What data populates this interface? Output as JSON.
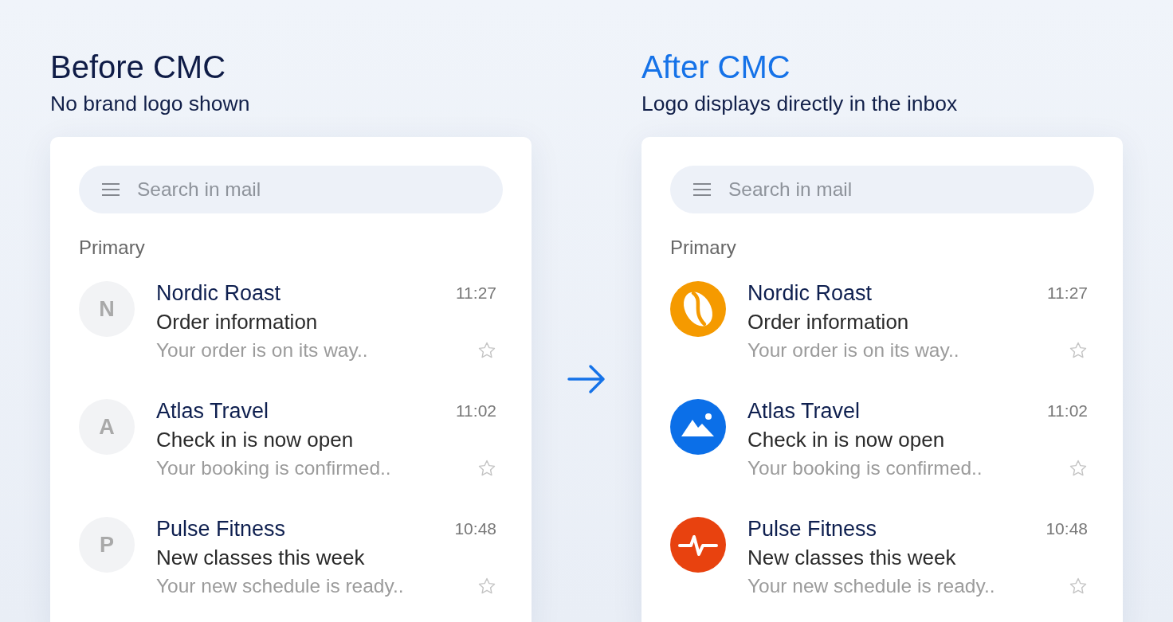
{
  "panels": [
    {
      "kind": "before",
      "title": "Before CMC",
      "subtitle": "No brand logo shown",
      "search": {
        "placeholder": "Search in mail"
      },
      "section": "Primary",
      "emails": [
        {
          "kind": "initial",
          "initial": "N",
          "sender": "Nordic Roast",
          "time": "11:27",
          "subject": "Order information",
          "preview": "Your order is on its way..",
          "starred": false
        },
        {
          "kind": "initial",
          "initial": "A",
          "sender": "Atlas Travel",
          "time": "11:02",
          "subject": "Check in is now open",
          "preview": "Your booking is confirmed..",
          "starred": false
        },
        {
          "kind": "initial",
          "initial": "P",
          "sender": "Pulse Fitness",
          "time": "10:48",
          "subject": "New classes this week",
          "preview": "Your new schedule is ready..",
          "starred": false
        }
      ]
    },
    {
      "kind": "after",
      "title": "After CMC",
      "subtitle": "Logo displays directly in the inbox",
      "search": {
        "placeholder": "Search in mail"
      },
      "section": "Primary",
      "emails": [
        {
          "kind": "logo",
          "color": "#f59a00",
          "sender": "Nordic Roast",
          "time": "11:27",
          "subject": "Order information",
          "preview": "Your order is on its way..",
          "starred": false
        },
        {
          "kind": "logo",
          "color": "#0b6fe8",
          "sender": "Atlas Travel",
          "time": "11:02",
          "subject": "Check in is now open",
          "preview": "Your booking is confirmed..",
          "starred": false
        },
        {
          "kind": "logo",
          "color": "#e8420f",
          "sender": "Pulse Fitness",
          "time": "10:48",
          "subject": "New classes this week",
          "preview": "Your new schedule is ready..",
          "starred": false
        }
      ]
    }
  ]
}
